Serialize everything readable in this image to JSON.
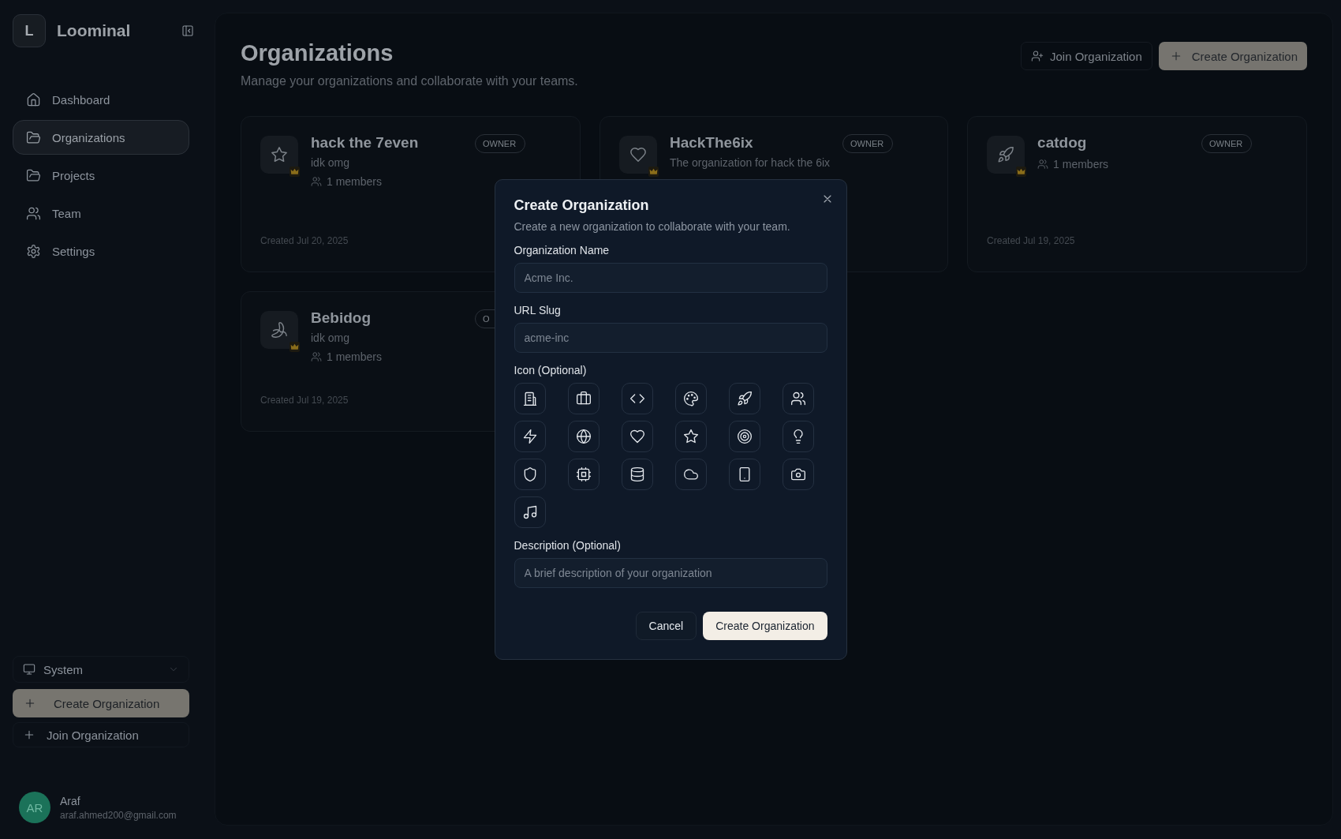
{
  "sidebar": {
    "logo_letter": "L",
    "app_name": "Loominal",
    "nav": [
      {
        "label": "Dashboard",
        "selected": false
      },
      {
        "label": "Organizations",
        "selected": true
      },
      {
        "label": "Projects",
        "selected": false
      },
      {
        "label": "Team",
        "selected": false
      },
      {
        "label": "Settings",
        "selected": false
      }
    ],
    "theme_select": {
      "value": "System"
    },
    "create_button": "Create Organization",
    "join_button": "Join Organization",
    "user": {
      "initials": "AR",
      "name": "Araf",
      "email": "araf.ahmed200@gmail.com"
    }
  },
  "header": {
    "title": "Organizations",
    "subtitle": "Manage your organizations and collaborate with your teams.",
    "join_button": "Join Organization",
    "create_button": "Create Organization"
  },
  "organizations": [
    {
      "name": "hack the 7even",
      "role": "OWNER",
      "description": "idk omg",
      "members": "1 members",
      "created": "Created Jul 20, 2025"
    },
    {
      "name": "HackThe6ix",
      "role": "OWNER",
      "description": "The organization for hack the 6ix"
    },
    {
      "name": "catdog",
      "role": "OWNER",
      "members": "1 members",
      "created": "Created Jul 19, 2025"
    },
    {
      "name": "Bebidog",
      "role": "O",
      "description": "idk omg",
      "members": "1 members",
      "created": "Created Jul 19, 2025"
    }
  ],
  "dialog": {
    "title": "Create Organization",
    "subtitle": "Create a new organization to collaborate with your team.",
    "name_label": "Organization Name",
    "name_placeholder": "Acme Inc.",
    "slug_label": "URL Slug",
    "slug_placeholder": "acme-inc",
    "icon_label": "Icon (Optional)",
    "icons": [
      {
        "selected": false
      },
      {
        "selected": false
      },
      {
        "selected": false
      },
      {
        "selected": false
      },
      {
        "selected": false
      },
      {
        "selected": false
      },
      {
        "selected": false
      },
      {
        "selected": false
      },
      {
        "selected": false
      },
      {
        "selected": false
      },
      {
        "selected": false
      },
      {
        "selected": false
      },
      {
        "selected": false
      },
      {
        "selected": false
      },
      {
        "selected": false
      },
      {
        "selected": false
      },
      {
        "selected": false
      },
      {
        "selected": false
      },
      {
        "selected": false
      }
    ],
    "description_label": "Description (Optional)",
    "description_placeholder": "A brief description of your organization",
    "cancel_button": "Cancel",
    "submit_button": "Create Organization"
  }
}
